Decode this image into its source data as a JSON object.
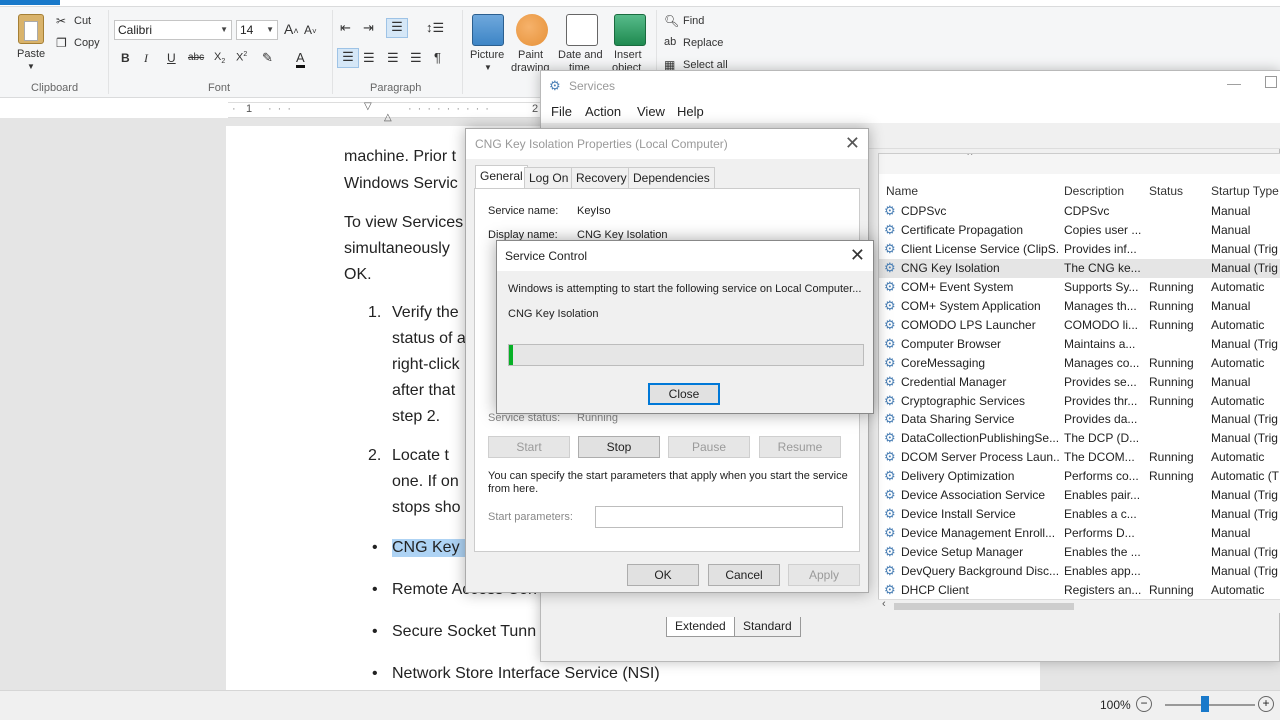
{
  "wordpad": {
    "clipboard": {
      "paste": "Paste",
      "cut": "Cut",
      "copy": "Copy",
      "group": "Clipboard"
    },
    "font": {
      "family": "Calibri",
      "size": "14",
      "group": "Font"
    },
    "paragraph": {
      "group": "Paragraph"
    },
    "insert": {
      "picture": "Picture",
      "paint": "Paint\ndrawing",
      "paint_l1": "Paint",
      "paint_l2": "drawing",
      "datetime_l1": "Date and",
      "datetime_l2": "time",
      "object_l1": "Insert",
      "object_l2": "object"
    },
    "editing": {
      "find": "Find",
      "replace": "Replace",
      "select_all": "Select all"
    },
    "ruler_marks": [
      "1",
      "2"
    ],
    "document": {
      "lines": [
        "machine. Prior t",
        "Windows Servic",
        "To view Services",
        "simultaneously",
        "OK."
      ],
      "list1": {
        "num": "1.",
        "lines": [
          "Verify the",
          "status of a",
          "right-click",
          "after that",
          "step 2."
        ]
      },
      "list2": {
        "num": "2.",
        "lines": [
          "Locate t",
          "one. If on",
          "stops sho"
        ]
      },
      "bullets": [
        "CNG Key I",
        "Remote Access Con",
        "Secure Socket Tunn",
        "Network Store Interface Service (NSI)"
      ]
    },
    "zoom": "100%"
  },
  "services": {
    "title": "Services",
    "menu": [
      "File",
      "Action",
      "View",
      "Help"
    ],
    "columns": [
      "Name",
      "Description",
      "Status",
      "Startup Type"
    ],
    "rows": [
      {
        "name": "CDPSvc",
        "desc": "CDPSvc",
        "status": "",
        "startup": "Manual"
      },
      {
        "name": "Certificate Propagation",
        "desc": "Copies user ...",
        "status": "",
        "startup": "Manual"
      },
      {
        "name": "Client License Service (ClipS...",
        "desc": "Provides inf...",
        "status": "",
        "startup": "Manual (Trig"
      },
      {
        "name": "CNG Key Isolation",
        "desc": "The CNG ke...",
        "status": "",
        "startup": "Manual (Trig"
      },
      {
        "name": "COM+ Event System",
        "desc": "Supports Sy...",
        "status": "Running",
        "startup": "Automatic"
      },
      {
        "name": "COM+ System Application",
        "desc": "Manages th...",
        "status": "Running",
        "startup": "Manual"
      },
      {
        "name": "COMODO LPS Launcher",
        "desc": "COMODO li...",
        "status": "Running",
        "startup": "Automatic"
      },
      {
        "name": "Computer Browser",
        "desc": "Maintains a...",
        "status": "",
        "startup": "Manual (Trig"
      },
      {
        "name": "CoreMessaging",
        "desc": "Manages co...",
        "status": "Running",
        "startup": "Automatic"
      },
      {
        "name": "Credential Manager",
        "desc": "Provides se...",
        "status": "Running",
        "startup": "Manual"
      },
      {
        "name": "Cryptographic Services",
        "desc": "Provides thr...",
        "status": "Running",
        "startup": "Automatic"
      },
      {
        "name": "Data Sharing Service",
        "desc": "Provides da...",
        "status": "",
        "startup": "Manual (Trig"
      },
      {
        "name": "DataCollectionPublishingSe...",
        "desc": "The DCP (D...",
        "status": "",
        "startup": "Manual (Trig"
      },
      {
        "name": "DCOM Server Process Laun...",
        "desc": "The DCOM...",
        "status": "Running",
        "startup": "Automatic"
      },
      {
        "name": "Delivery Optimization",
        "desc": "Performs co...",
        "status": "Running",
        "startup": "Automatic (T"
      },
      {
        "name": "Device Association Service",
        "desc": "Enables pair...",
        "status": "",
        "startup": "Manual (Trig"
      },
      {
        "name": "Device Install Service",
        "desc": "Enables a c...",
        "status": "",
        "startup": "Manual (Trig"
      },
      {
        "name": "Device Management Enroll...",
        "desc": "Performs D...",
        "status": "",
        "startup": "Manual"
      },
      {
        "name": "Device Setup Manager",
        "desc": "Enables the ...",
        "status": "",
        "startup": "Manual (Trig"
      },
      {
        "name": "DevQuery Background Disc...",
        "desc": "Enables app...",
        "status": "",
        "startup": "Manual (Trig"
      },
      {
        "name": "DHCP Client",
        "desc": "Registers an...",
        "status": "Running",
        "startup": "Automatic"
      }
    ],
    "tabs": [
      "Extended",
      "Standard"
    ]
  },
  "properties": {
    "title": "CNG Key Isolation Properties (Local Computer)",
    "tabs": [
      "General",
      "Log On",
      "Recovery",
      "Dependencies"
    ],
    "service_name_label": "Service name:",
    "service_name": "KeyIso",
    "display_name_label": "Display name:",
    "display_name": "CNG Key Isolation",
    "service_status_label": "Service status:",
    "service_status": "Running",
    "buttons": {
      "start": "Start",
      "stop": "Stop",
      "pause": "Pause",
      "resume": "Resume"
    },
    "hint": "You can specify the start parameters that apply when you start the service from here.",
    "hint_l1": "You can specify the start parameters that apply when you start the service",
    "hint_l2": "from here.",
    "start_params_label": "Start parameters:",
    "footer": {
      "ok": "OK",
      "cancel": "Cancel",
      "apply": "Apply"
    }
  },
  "service_control": {
    "title": "Service Control",
    "message": "Windows is attempting to start the following service on Local Computer...",
    "service": "CNG Key Isolation",
    "progress": 0.01,
    "close": "Close"
  },
  "colors": {
    "accent": "#1979ca",
    "progress": "#06b025",
    "selection": "#aed3f4"
  }
}
